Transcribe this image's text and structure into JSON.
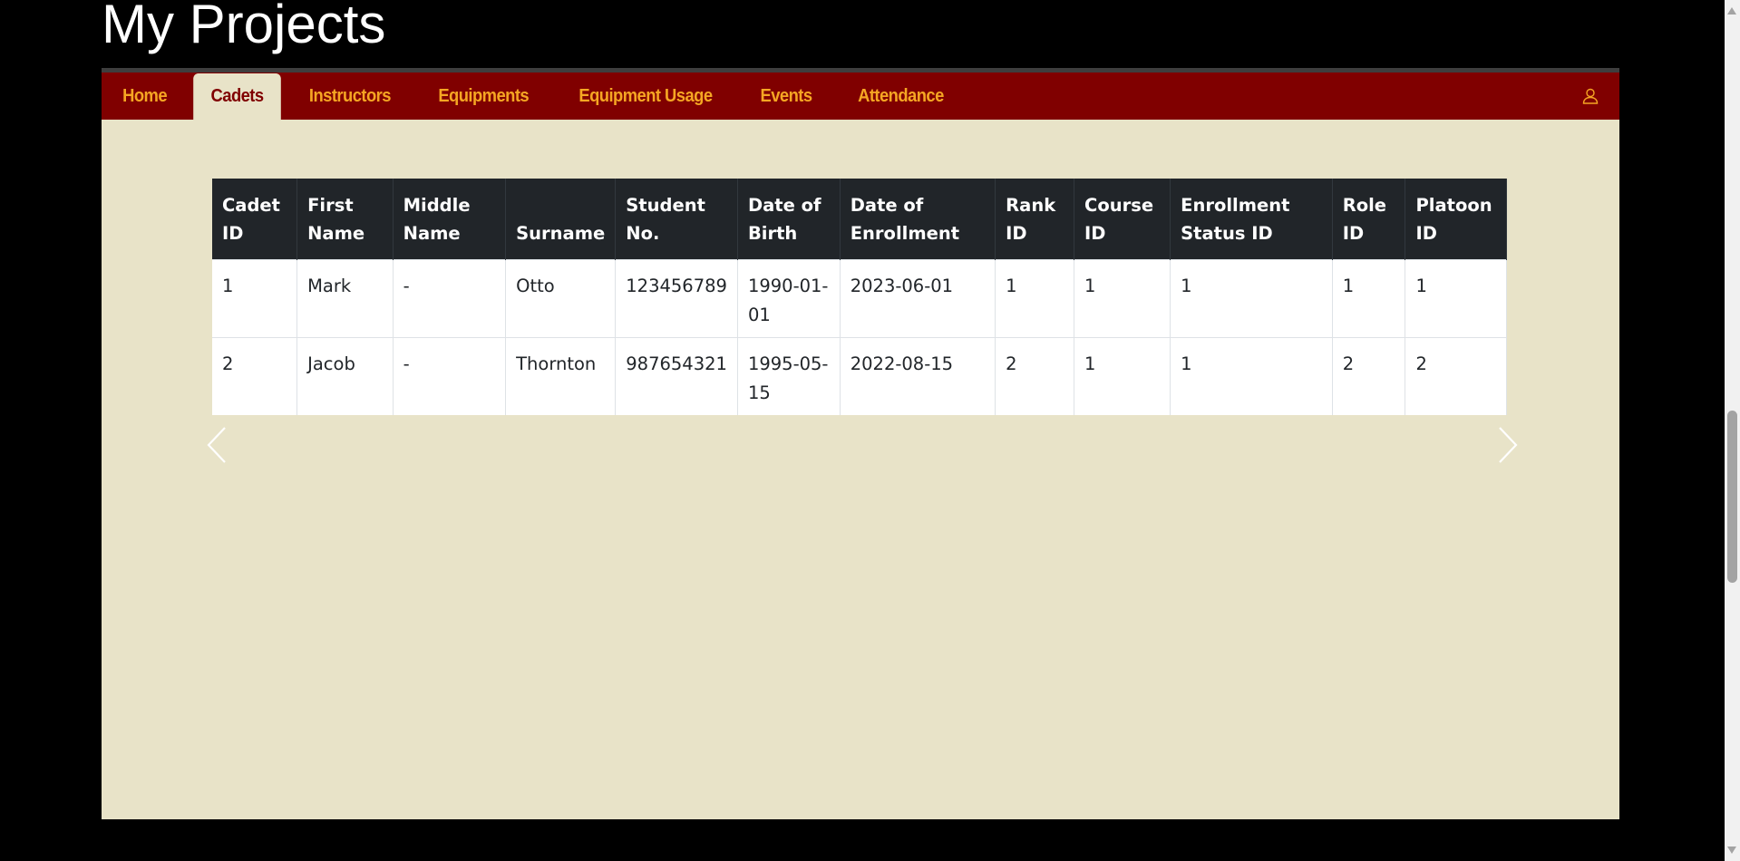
{
  "page": {
    "title": "My Projects"
  },
  "nav": {
    "tabs": [
      {
        "label": "Home",
        "active": false
      },
      {
        "label": "Cadets",
        "active": true
      },
      {
        "label": "Instructors",
        "active": false
      },
      {
        "label": "Equipments",
        "active": false
      },
      {
        "label": "Equipment Usage",
        "active": false
      },
      {
        "label": "Events",
        "active": false
      },
      {
        "label": "Attendance",
        "active": false
      }
    ],
    "user_icon": "user-icon"
  },
  "table": {
    "headers": [
      [
        "Cadet",
        "ID"
      ],
      [
        "First",
        "Name"
      ],
      [
        "Middle",
        "Name"
      ],
      [
        "",
        "Surname"
      ],
      [
        "Student",
        "No."
      ],
      [
        "Date of",
        "Birth"
      ],
      [
        "Date of",
        "Enrollment"
      ],
      [
        "Rank",
        "ID"
      ],
      [
        "Course",
        "ID"
      ],
      [
        "Enrollment",
        "Status ID"
      ],
      [
        "Role",
        "ID"
      ],
      [
        "Platoon",
        "ID"
      ]
    ],
    "rows": [
      [
        "1",
        "Mark",
        "-",
        "Otto",
        "123456789",
        "1990-01-01",
        "2023-06-01",
        "1",
        "1",
        "1",
        "1",
        "1"
      ],
      [
        "2",
        "Jacob",
        "-",
        "Thornton",
        "987654321",
        "1995-05-15",
        "2022-08-15",
        "2",
        "1",
        "1",
        "2",
        "2"
      ]
    ]
  },
  "carousel": {
    "prev_icon": "chevron-left-icon",
    "next_icon": "chevron-right-icon"
  },
  "colors": {
    "background": "#000000",
    "panel": "#e8e3c8",
    "navbar": "#800000",
    "nav_text": "#f5a623",
    "table_header": "#212529"
  }
}
